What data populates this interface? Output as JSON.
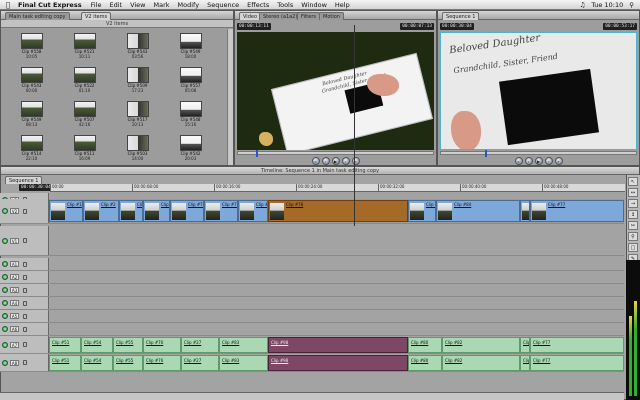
{
  "menubar": {
    "app": "Final Cut Express",
    "items": [
      "File",
      "Edit",
      "View",
      "Mark",
      "Modify",
      "Sequence",
      "Effects",
      "Tools",
      "Window",
      "Help"
    ],
    "clock": "Tue 10:10"
  },
  "browser": {
    "tabs": [
      "Main task editing copy",
      "V2 items"
    ],
    "title": "V2 items",
    "clips": [
      {
        "name": "Clip #558",
        "duration": "10:05"
      },
      {
        "name": "Clip #521",
        "duration": "10:11"
      },
      {
        "name": "Clip #543",
        "duration": "03:56"
      },
      {
        "name": "Clip #549",
        "duration": "18:00"
      },
      {
        "name": "Clip #543",
        "duration": "00:00"
      },
      {
        "name": "Clip #522",
        "duration": "01:10"
      },
      {
        "name": "Clip #509",
        "duration": "17:23"
      },
      {
        "name": "Clip #557",
        "duration": "05:08"
      },
      {
        "name": "Clip #549",
        "duration": "08:13"
      },
      {
        "name": "Clip #507",
        "duration": "42:16"
      },
      {
        "name": "Clip #517",
        "duration": "10:13"
      },
      {
        "name": "Clip #548",
        "duration": "15:16"
      },
      {
        "name": "Clip #514",
        "duration": "22:10"
      },
      {
        "name": "Clip #511",
        "duration": "16:09"
      },
      {
        "name": "Clip #503",
        "duration": "14:00"
      },
      {
        "name": "Clip #542",
        "duration": "20:03"
      },
      {
        "name": "Clip #539",
        "duration": "19:05"
      },
      {
        "name": "Clip #508",
        "duration": "11:18"
      },
      {
        "name": "Clip #516",
        "duration": "09:24"
      },
      {
        "name": "Clip #541",
        "duration": "13:07"
      }
    ]
  },
  "viewer": {
    "tabs": [
      "Video",
      "Stereo (a1a2)",
      "Filters",
      "Motion"
    ],
    "timecode_left": "00:00:13:11",
    "timecode_right": "00:00:07:13",
    "script_lines": [
      "Beloved Daughter",
      "Grandchild, Sister, Friend"
    ]
  },
  "canvas": {
    "tabs": [
      "Sequence 1"
    ],
    "timecode_left": "00:00:30:04",
    "timecode_right": "00:00:53:17",
    "script_lines": [
      "Beloved Daughter",
      "Grandchild, Sister, Friend"
    ]
  },
  "timeline": {
    "title": "Timeline: Sequence 1 in Main task editing copy",
    "sequence_tab": "Sequence 1",
    "timecode": "00:00:30:04",
    "ruler": [
      "00:00",
      "00:00:08:00",
      "00:00:16:00",
      "00:00:24:00",
      "00:00:32:00",
      "00:00:40:00",
      "00:00:48:00"
    ],
    "video_tracks": [
      {
        "id": "V3",
        "label": "V3"
      },
      {
        "id": "V2",
        "label": "V2"
      },
      {
        "id": "V1",
        "label": "V1"
      }
    ],
    "audio_tracks": [
      {
        "id": "A1",
        "label": "A1"
      },
      {
        "id": "A2",
        "label": "A2"
      },
      {
        "id": "A3",
        "label": "A3"
      },
      {
        "id": "A4",
        "label": "A4"
      },
      {
        "id": "A5",
        "label": "A5"
      },
      {
        "id": "A6",
        "label": "A6"
      },
      {
        "id": "A7",
        "label": "A7"
      },
      {
        "id": "A8",
        "label": "A8"
      }
    ],
    "v2_clips": [
      "Clip #1",
      "Clip #2",
      "Clip #53",
      "Clip #74",
      "Clip #75",
      "Clip #76",
      "Clip #37",
      "Clip #78",
      "Clip #83",
      "Clip #84",
      "Clip #76",
      "Clip #77"
    ],
    "a_clips_row1": [
      "Clip #51",
      "Clip #54",
      "Clip #55",
      "Clip #76",
      "Clip #27",
      "Clip #83",
      "Clip #98",
      "Clip #80",
      "Clip #82",
      "Clip #75",
      "Clip #77"
    ],
    "a_clips_row2": [
      "Clip #51",
      "Clip #54",
      "Clip #55",
      "Clip #76",
      "Clip #27",
      "Clip #83",
      "Clip #98",
      "Clip #80",
      "Clip #82",
      "Clip #75",
      "Clip #77"
    ]
  },
  "colors": {
    "video_clip": "#7ea8d9",
    "audio_clip": "#a9d8b3",
    "selected_video": "#a56a28",
    "selected_audio": "#7d4765"
  }
}
